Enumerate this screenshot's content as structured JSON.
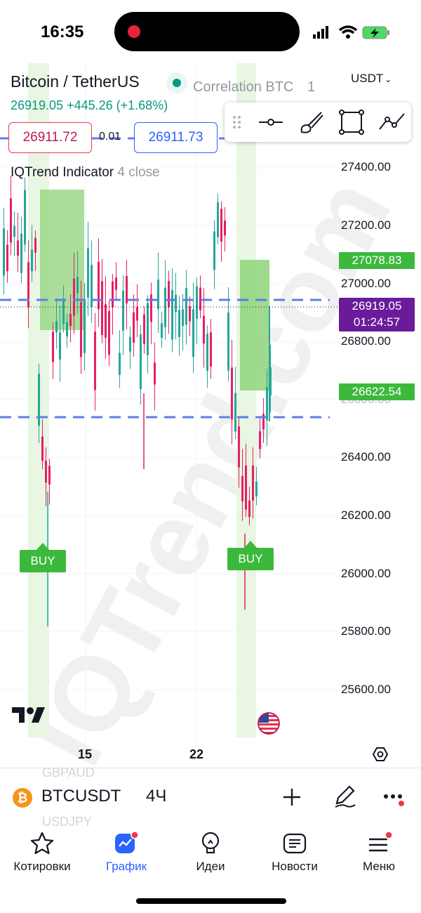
{
  "status_bar": {
    "time": "16:35"
  },
  "header": {
    "symbol_title": "Bitcoin / TetherUS",
    "price_change": "26919.05 +445.26 (+1.68%)",
    "correlation": "Correlation BTC",
    "correlation_value": "1",
    "currency": "USDT",
    "sell_price": "26911.72",
    "quantity": "0.01",
    "buy_price": "26911.73",
    "indicator_name": "IQTrend Indicator",
    "indicator_params": "4 close"
  },
  "chart": {
    "price_axis": [
      "27400.00",
      "27200.00",
      "27000.00",
      "26800.00",
      "26600.00",
      "26400.00",
      "26200.00",
      "26000.00",
      "25800.00",
      "25600.00"
    ],
    "tag_upper": "27078.83",
    "tag_lower": "26622.54",
    "last_price": "26919.05",
    "countdown": "01:24:57",
    "time_axis": [
      "15",
      "22"
    ],
    "signals": [
      "BUY",
      "BUY"
    ],
    "watermark": "IQTrend.com",
    "colors": {
      "up": "#26a69a",
      "down": "#e91e63",
      "zone": "#8fd37a",
      "last_tag": "#6a1b9a",
      "level_line": "#5b7fe8"
    }
  },
  "symbol_bar": {
    "symbol": "BTCUSDT",
    "interval": "4Ч",
    "ghost_above": "GBPAUD",
    "ghost_below": "USDJPY",
    "icons": [
      "bitcoin-icon",
      "plus-icon",
      "pen-icon",
      "more-icon"
    ]
  },
  "tabs": [
    {
      "label": "Котировки",
      "icon": "star-icon"
    },
    {
      "label": "График",
      "icon": "chart-icon"
    },
    {
      "label": "Идеи",
      "icon": "lightbulb-icon"
    },
    {
      "label": "Новости",
      "icon": "news-icon"
    },
    {
      "label": "Меню",
      "icon": "menu-icon"
    }
  ]
}
